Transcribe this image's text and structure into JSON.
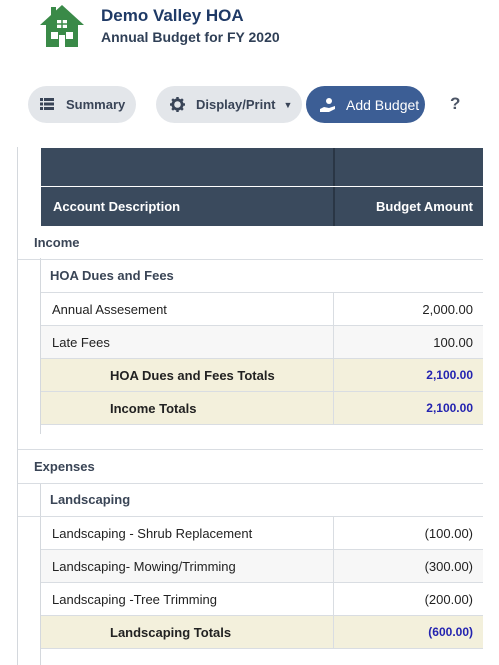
{
  "header": {
    "org_name": "Demo Valley HOA",
    "subtitle": "Annual Budget for FY 2020",
    "logo_icon": "house-icon",
    "brand_color": "#3a8a48"
  },
  "toolbar": {
    "summary_label": "Summary",
    "display_label": "Display/Print",
    "add_label": "Add Budget",
    "help_label": "?"
  },
  "table": {
    "col_desc": "Account Description",
    "col_amount": "Budget Amount",
    "income": {
      "label": "Income",
      "group_label": "HOA Dues and Fees",
      "rows": [
        {
          "desc": "Annual Assesement",
          "amount": "2,000.00"
        },
        {
          "desc": "Late Fees",
          "amount": "100.00"
        }
      ],
      "group_total_label": "HOA Dues and Fees Totals",
      "group_total": "2,100.00",
      "total_label": "Income Totals",
      "total": "2,100.00"
    },
    "expenses": {
      "label": "Expenses",
      "group_label": "Landscaping",
      "rows": [
        {
          "desc": "Landscaping - Shrub Replacement",
          "amount": "(100.00)"
        },
        {
          "desc": "Landscaping- Mowing/Trimming",
          "amount": "(300.00)"
        },
        {
          "desc": "Landscaping -Tree Trimming",
          "amount": "(200.00)"
        }
      ],
      "group_total_label": "Landscaping Totals",
      "group_total": "(600.00)"
    }
  }
}
